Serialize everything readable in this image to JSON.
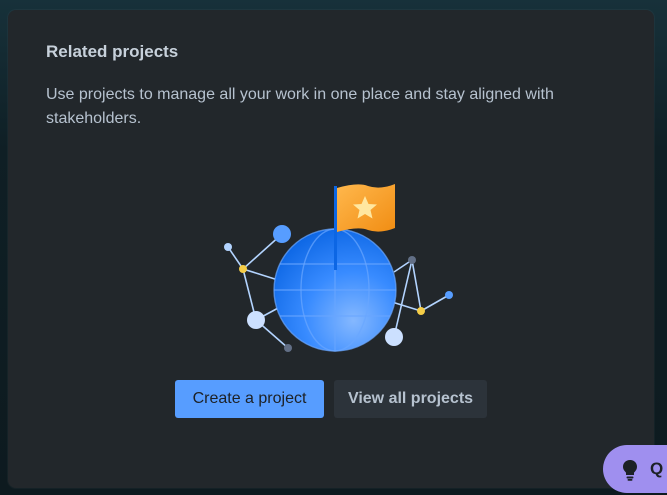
{
  "panel": {
    "title": "Related projects",
    "description": "Use projects to manage all your work in one place and stay aligned with stakeholders."
  },
  "illustration": {
    "globe_color": "#1d7afc",
    "flag_color": "#f5a623",
    "star_color": "#ffe7a0"
  },
  "buttons": {
    "create_label": "Create a project",
    "view_all_label": "View all projects"
  },
  "fab": {
    "icon": "lightbulb-icon",
    "label": "Q"
  },
  "colors": {
    "primary": "#579dff",
    "surface": "#22272b",
    "fab": "#9f8fef"
  }
}
